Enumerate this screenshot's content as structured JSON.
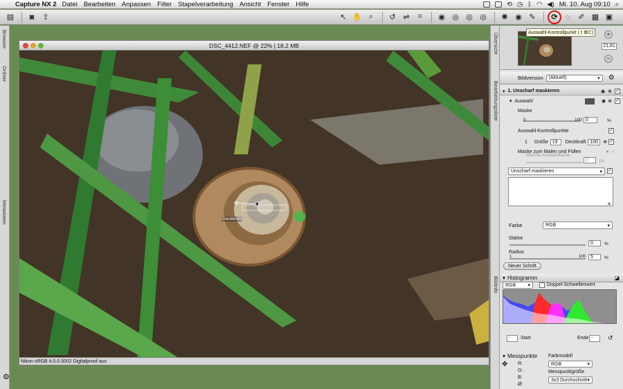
{
  "menubar": {
    "app": "Capture NX 2",
    "items": [
      "Datei",
      "Bearbeiten",
      "Anpassen",
      "Filter",
      "Stapelverarbeitung",
      "Ansicht",
      "Fenster",
      "Hilfe"
    ],
    "clock": "Mi. 10. Aug  09:10"
  },
  "toolbar": {
    "tooltip": "Auswahl-Kontrollpunkt (⇧⌘C)",
    "highlight_color": "#d11111"
  },
  "left_tabs": [
    "Browser",
    "Ordner",
    "Metadaten"
  ],
  "right_tabs": [
    "Übersicht",
    "Bearbeitungsliste",
    "Bildinfo"
  ],
  "window": {
    "title": "DSC_4412.NEF @ 22% | 18.2 MB",
    "status": "Nikon sRGB 4.0.0.3002  Digitalproof aus",
    "cp_label": "Deckkraft"
  },
  "overview": {
    "zoom": "21,81"
  },
  "edit": {
    "bildversion_label": "Bildversion",
    "bildversion_value": "(Aktuell)",
    "step_title": "1. Unscharf maskieren",
    "auswahl": "Auswahl",
    "maske": "Maske",
    "maske_min": "0",
    "maske_max": "100",
    "maske_value": "0",
    "percent": "%",
    "kontrollpunkte": "Auswahl-Kontrollpunkte",
    "kp_index": "1",
    "groesse_label": "Größe",
    "groesse_value": "19",
    "deckkraft_label": "Deckkraft",
    "deckkraft_value": "100",
    "maske_malen": "Maske zum Malen und Füllen",
    "weiche": "Weiche Auswahlkante",
    "weiche_value": "0",
    "px": "px",
    "filter_select": "Unscharf maskieren",
    "farbe_label": "Farbe",
    "farbe_value": "RGB",
    "staerke_label": "Stärke",
    "staerke_value": "0",
    "radius_label": "Radius",
    "radius_min": "1",
    "radius_max": "100",
    "radius_value": "5",
    "new_step_button": "Neuer Schritt"
  },
  "histogram": {
    "title": "Histogramm",
    "channel": "RGB",
    "double_threshold": "Doppel-Schwellenwert",
    "start_label": "Start",
    "start_value": "-",
    "end_label": "Ende",
    "end_value": "-"
  },
  "messpunkte": {
    "title": "Messpunkte",
    "channels": [
      "R:",
      "G:",
      "B:",
      "Ø:"
    ],
    "farbmodell_label": "Farbmodell",
    "farbmodell_value": "RGB",
    "groesse_label": "Messpunktgröße",
    "groesse_value": "3x3 Durchschnitt"
  }
}
